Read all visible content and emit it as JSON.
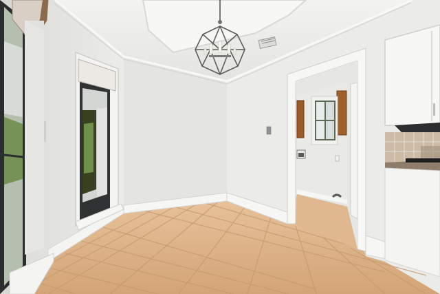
{
  "scene": {
    "description_tag": "photo",
    "palette": {
      "wall": "#e9e9e6",
      "wall_shadow": "#d6d6d2",
      "ceiling": "#efefec",
      "floor_light": "#e2b98f",
      "floor_dark": "#c99a6c",
      "grout": "#b98e65",
      "trim": "#f4f4f2",
      "cabinet_wood": "#a0602a",
      "counter": "#8a7a68",
      "backsplash": "#cbb8a4",
      "window_glass": "#b8bdbf",
      "foliage": "#6f8f4a",
      "chandelier": "#6e6e6e"
    }
  }
}
